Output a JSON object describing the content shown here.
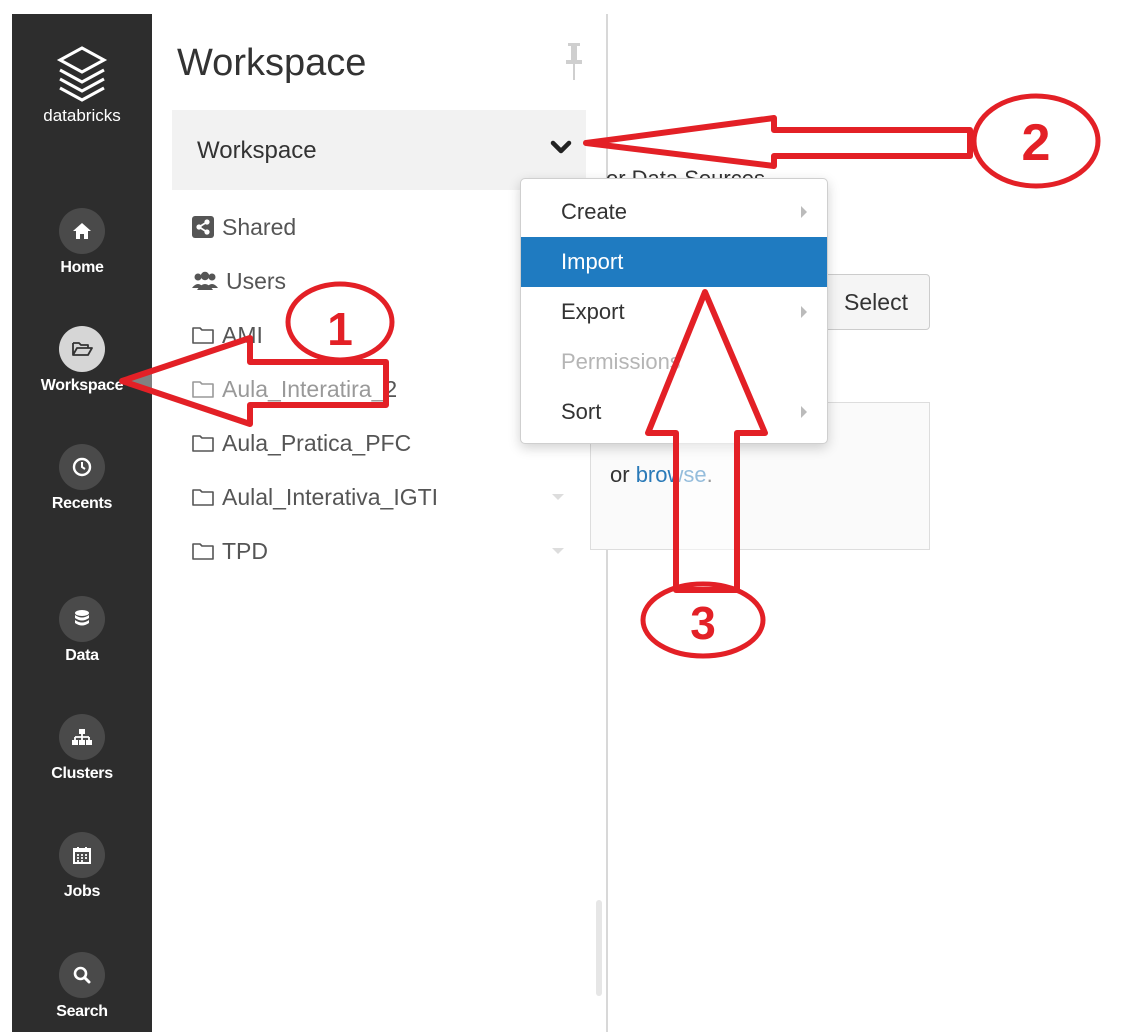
{
  "brand": {
    "label": "databricks"
  },
  "nav": {
    "items": [
      {
        "label": "Home",
        "icon": "home-icon"
      },
      {
        "label": "Workspace",
        "icon": "folder-open-icon",
        "active": true
      },
      {
        "label": "Recents",
        "icon": "clock-icon"
      },
      {
        "label": "Data",
        "icon": "database-icon"
      },
      {
        "label": "Clusters",
        "icon": "sitemap-icon"
      },
      {
        "label": "Jobs",
        "icon": "calendar-icon"
      },
      {
        "label": "Search",
        "icon": "search-icon"
      }
    ]
  },
  "panel": {
    "title": "Workspace",
    "header_label": "Workspace",
    "items": [
      {
        "label": "Shared",
        "icon": "share-icon"
      },
      {
        "label": "Users",
        "icon": "users-icon"
      },
      {
        "label": "AMI",
        "icon": "folder-icon"
      },
      {
        "label": "Aula_Interatira_2",
        "icon": "folder-icon"
      },
      {
        "label": "Aula_Pratica_PFC",
        "icon": "folder-icon"
      },
      {
        "label": "Aulal_Interativa_IGTI",
        "icon": "folder-icon"
      },
      {
        "label": "TPD",
        "icon": "folder-icon"
      }
    ]
  },
  "menu": {
    "items": [
      {
        "label": "Create",
        "has_submenu": true
      },
      {
        "label": "Import",
        "highlighted": true
      },
      {
        "label": "Export",
        "has_submenu": true
      },
      {
        "label": "Permissions",
        "disabled": true
      },
      {
        "label": "Sort",
        "has_submenu": true
      }
    ]
  },
  "main": {
    "partial_heading": "or Data Sources",
    "select_label": "Select",
    "drop_prefix": "or ",
    "browse_link": "browse",
    "drop_suffix": "."
  },
  "annotations": {
    "labels": [
      "1",
      "2",
      "3"
    ],
    "color": "#e32026"
  },
  "colors": {
    "rail": "#2d2d2d",
    "highlight": "#1f7bc1",
    "link": "#2a7ab8"
  }
}
